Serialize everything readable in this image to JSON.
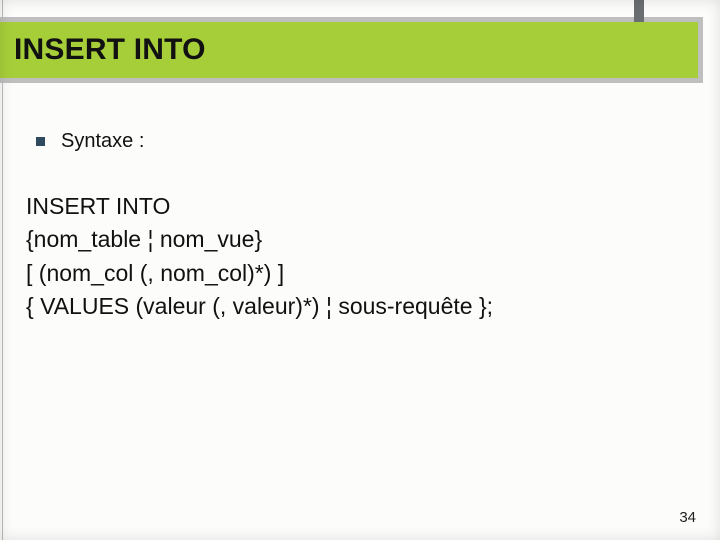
{
  "title": "INSERT INTO",
  "bullet": {
    "label": "Syntaxe :"
  },
  "syntax": {
    "line1": "INSERT INTO",
    "line2": "{nom_table ¦ nom_vue}",
    "line3": "[ (nom_col (, nom_col)*) ]",
    "line4": "{ VALUES (valeur (, valeur)*) ¦ sous-requête };"
  },
  "page_number": "34",
  "colors": {
    "accent": "#a6ce39",
    "frame": "#bfbfbf",
    "corner": "#6b6e70",
    "bullet": "#2f4a5e"
  }
}
